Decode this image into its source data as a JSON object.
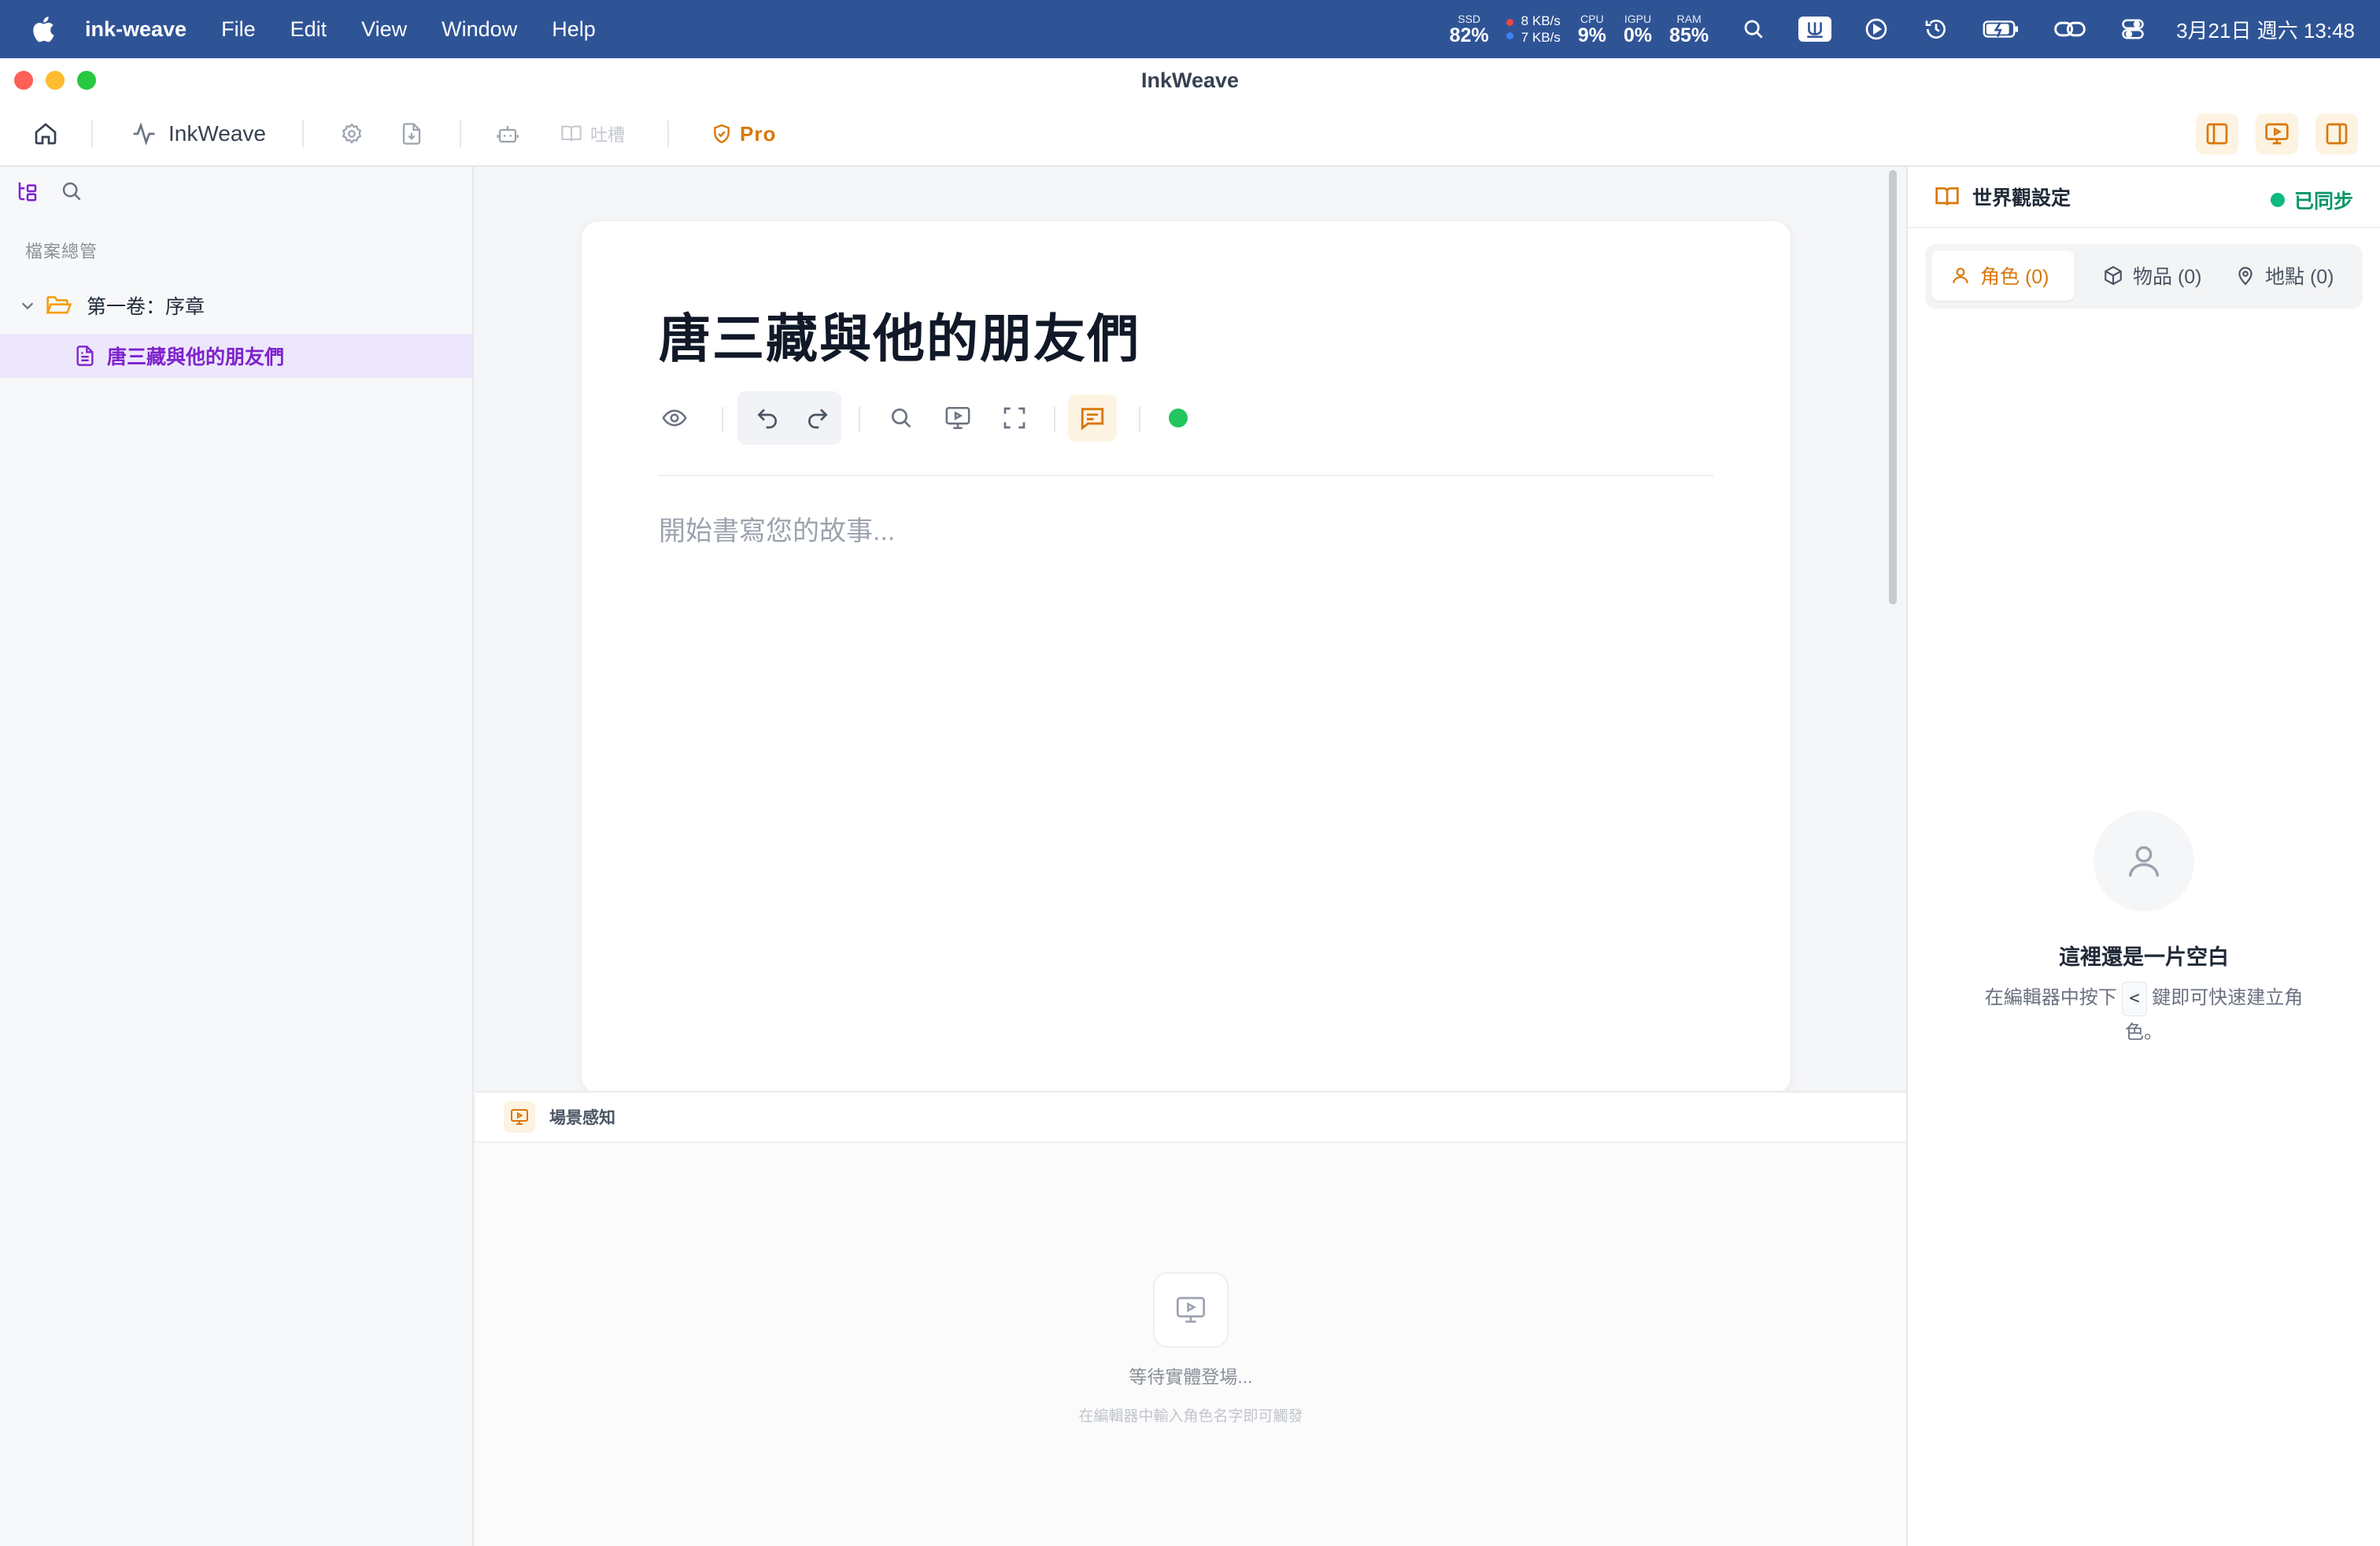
{
  "menubar": {
    "app_name": "ink-weave",
    "menus": [
      "File",
      "Edit",
      "View",
      "Window",
      "Help"
    ],
    "stats": {
      "ssd_label": "SSD",
      "ssd_value": "82%",
      "net_up": "8 KB/s",
      "net_down": "7 KB/s",
      "cpu_label": "CPU",
      "cpu_value": "9%",
      "gpu_label": "IGPU",
      "gpu_value": "0%",
      "ram_label": "RAM",
      "ram_value": "85%"
    },
    "icons": [
      "search-icon",
      "input-method-icon",
      "play-circle-icon",
      "time-machine-icon",
      "battery-charging-icon",
      "link-icon",
      "control-center-icon"
    ],
    "clock": "3月21日 週六 13:48"
  },
  "window": {
    "title": "InkWeave"
  },
  "toolbar": {
    "brand": "InkWeave",
    "tucao": "吐槽",
    "pro": "Pro",
    "accent": "#d97706"
  },
  "sidebar": {
    "section_title": "檔案總管",
    "folder": "第一卷：序章",
    "file": "唐三藏與他的朋友們",
    "active_color": "#7e22ce"
  },
  "editor": {
    "doc_title": "唐三藏與他的朋友們",
    "placeholder": "開始書寫您的故事...",
    "status_color": "#22c55e"
  },
  "scene": {
    "title": "場景感知",
    "empty_title": "等待實體登場...",
    "empty_hint": "在編輯器中輸入角色名字即可觸發"
  },
  "worldview": {
    "title": "世界觀設定",
    "sync_status": "已同步",
    "tabs": [
      "角色 (0)",
      "物品 (0)",
      "地點 (0)"
    ],
    "empty_title": "這裡還是一片空白",
    "empty_desc_pre": "在編輯器中按下",
    "empty_key": "<",
    "empty_desc_post": "鍵即可快速建立角色。"
  }
}
